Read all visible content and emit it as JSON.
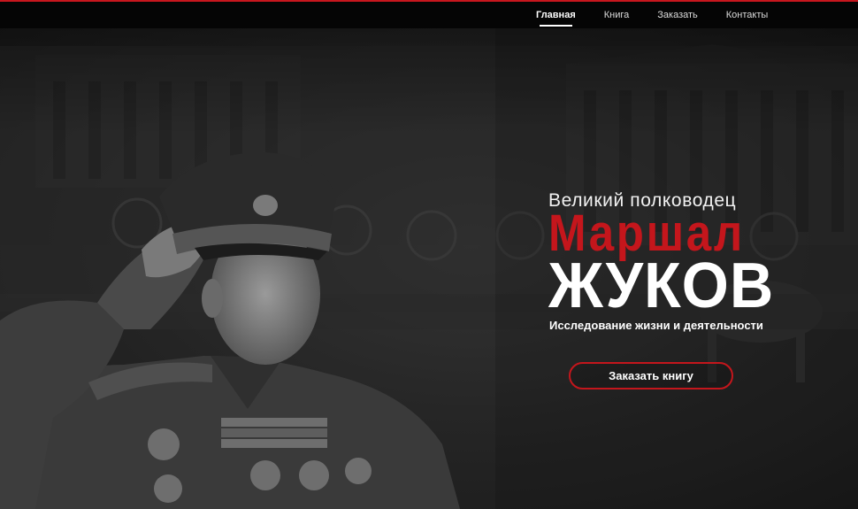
{
  "nav": {
    "items": [
      {
        "label": "Главная",
        "active": true
      },
      {
        "label": "Книга",
        "active": false
      },
      {
        "label": "Заказать",
        "active": false
      },
      {
        "label": "Контакты",
        "active": false
      }
    ]
  },
  "hero": {
    "subtitle": "Великий полководец",
    "name_line1": "Маршал",
    "name_line2": "ЖУКОВ",
    "tagline": "Исследование жизни и деятельности",
    "button_label": "Заказать книгу"
  },
  "colors": {
    "accent": "#c4161c",
    "navbar": "#050505",
    "background": "#262626"
  }
}
